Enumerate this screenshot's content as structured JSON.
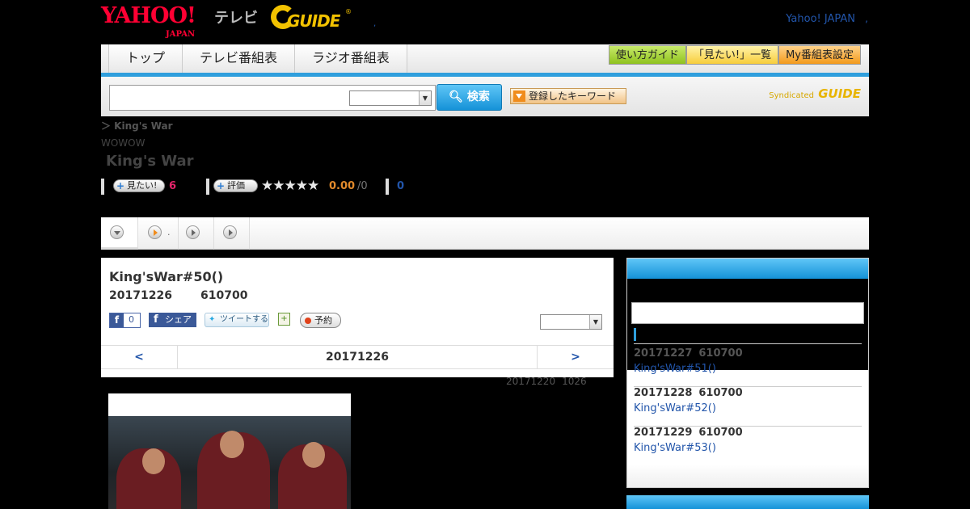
{
  "header": {
    "yahoo_logo": "YAHOO!",
    "yahoo_logo_sub": "JAPAN",
    "tv_label": "テレビ",
    "gguide_logo": "GUIDE",
    "separator": ",",
    "yahoo_japan_link": "Yahoo! JAPAN",
    "link_dot": ","
  },
  "nav": {
    "tabs": [
      "トップ",
      "テレビ番組表",
      "ラジオ番組表"
    ],
    "right_buttons": [
      "使い方ガイド",
      "「見たい!」一覧",
      "My番組表設定"
    ]
  },
  "search": {
    "button_label": "検索",
    "keyword_button": "登録したキーワード",
    "syndicated": "Syndicated",
    "syndicated_logo": "GUIDE"
  },
  "program": {
    "breadcrumb": "＞  King's War",
    "channel": "WOWOW",
    "title": "King's War",
    "mitai_label": "見たい!",
    "mitai_count": "6",
    "rating_label": "評価",
    "stars": "★★★★★",
    "score": "0.00",
    "score_of": "/0",
    "review_link": "0"
  },
  "play_tabs": {
    "dot": "."
  },
  "episode": {
    "title": "King'sWar#50()",
    "date": "20171226",
    "time": "610700",
    "fb_like_count": "0",
    "fb_share": "シェア",
    "tweet": "ツイートする",
    "reserve": "予約",
    "nav_prev": "<",
    "nav_current": "20171226",
    "nav_next": ">",
    "updated_date": "20171220",
    "updated_time": "1026"
  },
  "sidebar": {
    "items": [
      {
        "date": "20171227",
        "time": "610700",
        "title": "King'sWar#51()"
      },
      {
        "date": "20171228",
        "time": "610700",
        "title": "King'sWar#52()"
      },
      {
        "date": "20171229",
        "time": "610700",
        "title": "King'sWar#53()"
      }
    ]
  },
  "colors": {
    "accent_blue": "#2f9fdd",
    "yahoo_red": "#ff0033",
    "gguide_yellow": "#f2c200",
    "mitai_pink": "#e2246a",
    "score_orange": "#e28a2b"
  }
}
